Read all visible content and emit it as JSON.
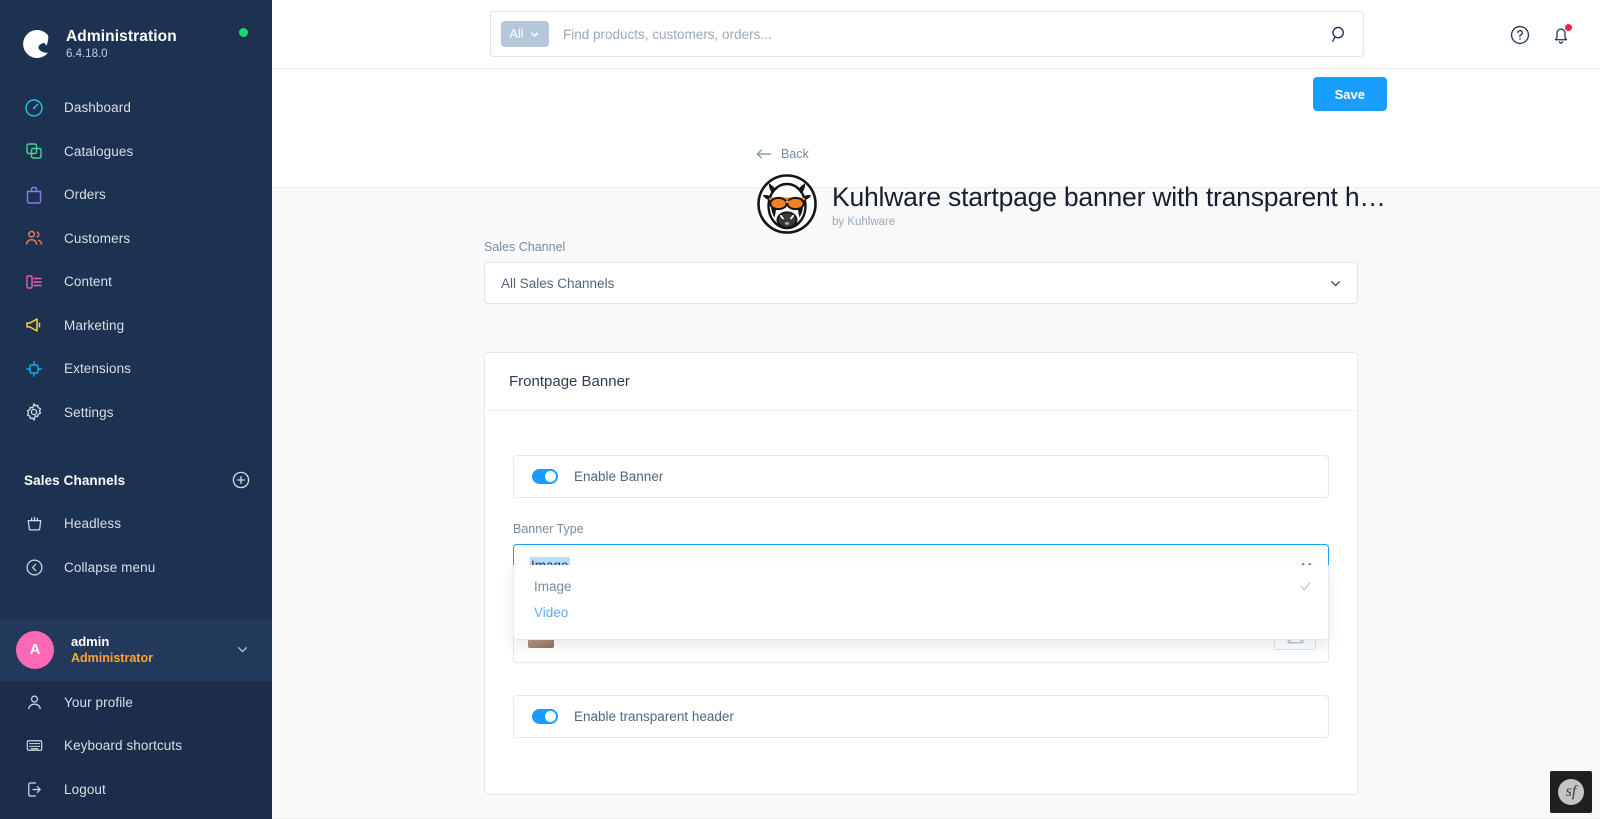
{
  "sidebar": {
    "brand": {
      "title": "Administration",
      "version": "6.4.18.0",
      "status": "online"
    },
    "nav": [
      {
        "label": "Dashboard",
        "icon": "dashboard-icon"
      },
      {
        "label": "Catalogues",
        "icon": "catalogues-icon"
      },
      {
        "label": "Orders",
        "icon": "orders-icon"
      },
      {
        "label": "Customers",
        "icon": "customers-icon"
      },
      {
        "label": "Content",
        "icon": "content-icon"
      },
      {
        "label": "Marketing",
        "icon": "marketing-icon"
      },
      {
        "label": "Extensions",
        "icon": "extensions-icon"
      },
      {
        "label": "Settings",
        "icon": "settings-icon"
      }
    ],
    "sales_channels": {
      "title": "Sales Channels",
      "add_icon": "plus-circle-icon",
      "items": [
        {
          "label": "Headless",
          "icon": "basket-icon"
        },
        {
          "label": "Collapse menu",
          "icon": "chevron-left-circle-icon"
        }
      ]
    },
    "user": {
      "initial": "A",
      "name": "admin",
      "role": "Administrator",
      "chevron": "chevron-down-icon"
    },
    "footer": [
      {
        "label": "Your profile",
        "icon": "user-icon"
      },
      {
        "label": "Keyboard shortcuts",
        "icon": "keyboard-icon"
      },
      {
        "label": "Logout",
        "icon": "logout-icon"
      }
    ],
    "colors": {
      "background": "#1d3151",
      "user_background": "#22395c",
      "footer_background": "#1b2d4b",
      "avatar": "#ff68b4",
      "role": "#ffa726",
      "status_dot": "#1cd66e"
    }
  },
  "topbar": {
    "scope_label": "All",
    "scope_chevron": "chevron-down-icon",
    "search_placeholder": "Find products, customers, orders...",
    "search_value": "",
    "search_icon": "search-icon",
    "help_icon": "help-circle-icon",
    "notification_icon": "bell-icon",
    "notification_badge": "#de294c"
  },
  "header": {
    "back_label": "Back",
    "back_icon": "arrow-left-icon",
    "logo_icon": "cow-sunglasses-logo",
    "title": "Kuhlware startpage banner with transparent h…",
    "author": "by Kuhlware",
    "save_label": "Save",
    "save_color": "#189eff"
  },
  "content": {
    "sales_channel": {
      "label": "Sales Channel",
      "value": "All Sales Channels",
      "chevron": "chevron-down-icon"
    },
    "card": {
      "title": "Frontpage Banner",
      "enable_banner": {
        "label": "Enable Banner",
        "state": "on"
      },
      "banner_type": {
        "label": "Banner Type",
        "value": "Image",
        "chevron": "chevron-down-icon",
        "expanded": true,
        "options": [
          {
            "label": "Image",
            "selected": true,
            "check_icon": "check-icon"
          },
          {
            "label": "Video",
            "selected": false,
            "hovered": true
          }
        ]
      },
      "media_field": {
        "thumb_icon": "image-thumbnail",
        "action_icon": "upload-image-icon"
      },
      "enable_transparent_header": {
        "label": "Enable transparent header",
        "state": "on"
      }
    }
  },
  "debug_toolbar": {
    "icon": "symfony-icon",
    "glyph": "sf"
  }
}
